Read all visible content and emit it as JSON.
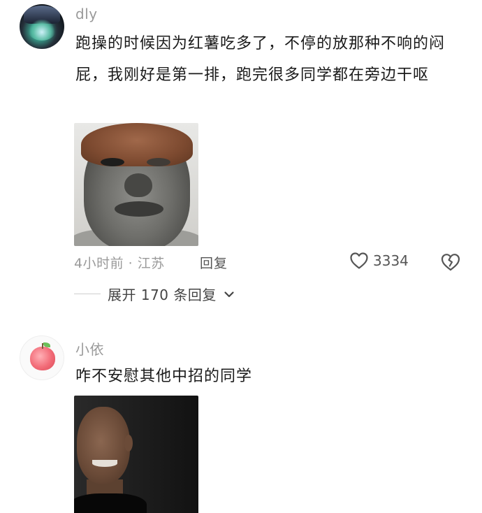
{
  "comments": [
    {
      "username": "dly",
      "text": "跑操的时候因为红薯吃多了，不停的放那种不响的闷屁，我刚好是第一排，跑完很多同学都在旁边干呕",
      "meta": "4小时前 · 江苏",
      "reply_label": "回复",
      "like_count": "3334",
      "expand_label": "展开 170 条回复"
    },
    {
      "username": "小依",
      "text": "咋不安慰其他中招的同学"
    }
  ],
  "icons": {
    "like": "heart-outline-icon",
    "dislike": "broken-heart-icon",
    "expand": "chevron-down-icon"
  },
  "colors": {
    "meta_text": "#9a9a9a",
    "body_text": "#1a1a1a",
    "icon": "#555555"
  }
}
